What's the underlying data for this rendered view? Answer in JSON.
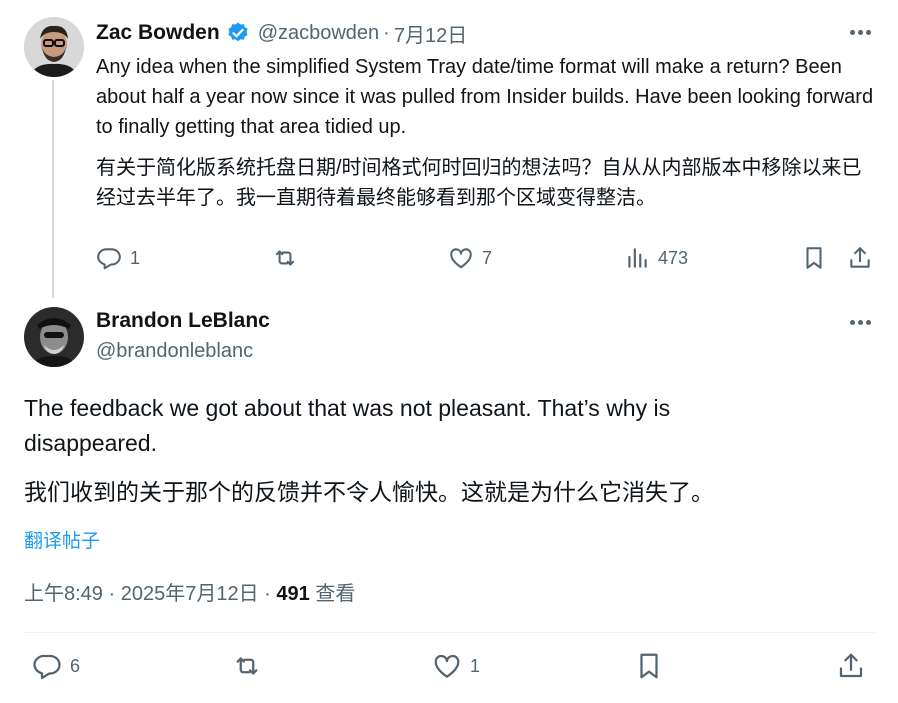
{
  "tweet1": {
    "author": {
      "name": "Zac Bowden",
      "handle": "@zacbowden",
      "verified": true
    },
    "separator": "·",
    "date": "7月12日",
    "text": "Any idea when the simplified System Tray date/time format will make a return? Been about half a year now since it was pulled from Insider builds. Have been looking forward to finally getting that area tidied up.",
    "translation": "有关于简化版系统托盘日期/时间格式何时回归的想法吗？自从从内部版本中移除以来已经过去半年了。我一直期待着最终能够看到那个区域变得整洁。",
    "actions": {
      "replies": "1",
      "likes": "7",
      "views": "473"
    }
  },
  "tweet2": {
    "author": {
      "name": "Brandon LeBlanc",
      "handle": "@brandonleblanc"
    },
    "text": "The feedback we got about that was not pleasant. That’s why is disappeared.",
    "translation": "我们收到的关于那个的反馈并不令人愉快。这就是为什么它消失了。",
    "translate_link": "翻译帖子",
    "time": "上午8:49",
    "separator": "·",
    "full_date": "2025年7月12日",
    "views_count": "491",
    "views_label": "查看",
    "actions": {
      "replies": "6",
      "likes": "1"
    }
  },
  "colors": {
    "text": "#0f1419",
    "secondary": "#536471",
    "link": "#1d9bf0",
    "verified": "#1d9bf0",
    "divider": "#eff3f4"
  },
  "icons": [
    "reply-icon",
    "repost-icon",
    "like-icon",
    "views-icon",
    "bookmark-icon",
    "share-icon",
    "more-icon",
    "verified-badge-icon"
  ]
}
